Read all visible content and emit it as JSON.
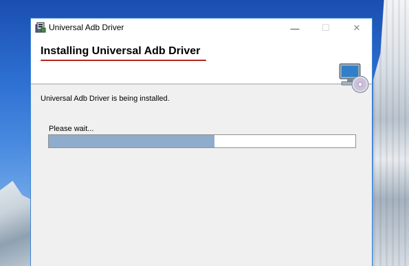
{
  "window": {
    "title": "Universal Adb Driver",
    "controls": {
      "minimize": "—",
      "maximize": "☐",
      "close": "✕"
    }
  },
  "header": {
    "title": "Installing Universal Adb Driver",
    "icon": "computer-disc-icon"
  },
  "body": {
    "status": "Universal Adb Driver is being installed.",
    "progress_label": "Please wait...",
    "progress_fraction": 0.54
  },
  "colors": {
    "accent_underline": "#b3261e",
    "progress_fill": "#8eaccb",
    "window_border": "#3c83d6"
  }
}
